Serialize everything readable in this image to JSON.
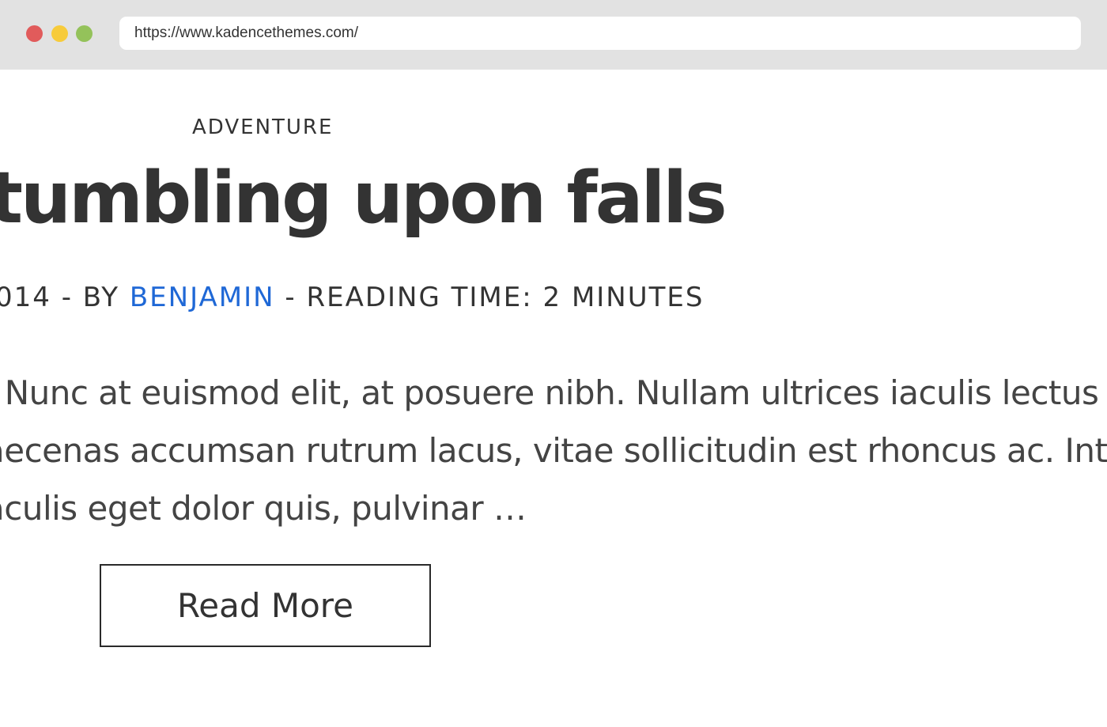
{
  "browser": {
    "url": "https://www.kadencethemes.com/",
    "window_controls": [
      "close-dot",
      "minimize-dot",
      "maximize-dot"
    ],
    "colors": {
      "close": "#e15b5b",
      "minimize": "#f7cb3b",
      "maximize": "#94c25a"
    }
  },
  "post": {
    "category": "ADVENTURE",
    "title": "tumbling upon falls",
    "meta": {
      "date_fragment": "014",
      "by_label": "- BY",
      "author": "BENJAMIN",
      "reading_time": "- READING TIME: 2 MINUTES"
    },
    "excerpt_lines": [
      ". Nunc at euismod elit, at posuere nibh. Nullam ultrices iaculis lectus",
      "aecenas accumsan rutrum lacus, vitae sollicitudin est rhoncus ac. Int",
      "aculis eget dolor quis, pulvinar …"
    ],
    "read_more_label": "Read More"
  },
  "colors": {
    "author_link": "#1f68d6",
    "text": "#333333"
  }
}
